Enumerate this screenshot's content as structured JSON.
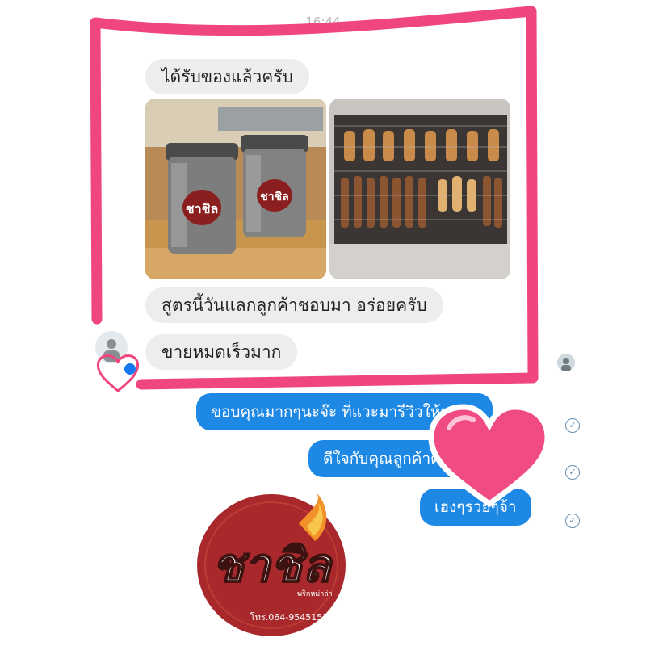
{
  "header": {
    "time": "16:44"
  },
  "incoming_messages": [
    "ได้รับของแล้วครับ",
    "สูตรนี้วันแลกลูกค้าชอบมา อร่อยครับ",
    "ขายหมดเร็วมาก"
  ],
  "outgoing_messages": [
    "ขอบคุณมากๆนะจ๊ะ ที่แวะมารีวิวให้นะคะ",
    "ดีใจกับคุณลูกค้าด้วยนะคะ",
    "เฮงๆรวยๆจ้า"
  ],
  "logo": {
    "brand": "ชาชิล",
    "subtitle": "พริกหม่าล่า",
    "phone": "โทร.064-9545151"
  },
  "colors": {
    "highlight_frame": "#f0467e",
    "outgoing_bubble": "#1e88e5",
    "incoming_bubble": "#ededed",
    "heart": "#f04b82",
    "logo_red": "#a8282b"
  },
  "icons": [
    "read-receipt-check-icon",
    "messenger-badge-icon",
    "heart-sticker-icon"
  ]
}
